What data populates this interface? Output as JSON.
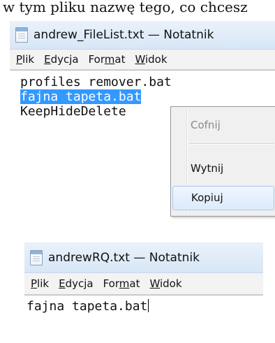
{
  "caption": "w tym pliku nazwę tego, co chcesz",
  "window_top": {
    "title": "andrew_FileList.txt — Notatnik",
    "icon": "notepad-icon",
    "menu": [
      {
        "pre": "",
        "key": "P",
        "post": "lik"
      },
      {
        "pre": "",
        "key": "E",
        "post": "dycja"
      },
      {
        "pre": "For",
        "key": "m",
        "post": "at"
      },
      {
        "pre": "",
        "key": "W",
        "post": "idok"
      }
    ],
    "lines": {
      "line1": "profiles remover.bat",
      "line2_selected": "fajna tapeta.bat",
      "line3": "KeepHideDelete"
    },
    "context_menu": {
      "undo": "Cofnij",
      "cut": "Wytnij",
      "copy": "Kopiuj",
      "highlight_color": "#dcebfc"
    },
    "selection_color": "#3399ff"
  },
  "window_bottom": {
    "title": "andrewRQ.txt — Notatnik",
    "icon": "notepad-icon",
    "menu": [
      {
        "pre": "",
        "key": "P",
        "post": "lik"
      },
      {
        "pre": "",
        "key": "E",
        "post": "dycja"
      },
      {
        "pre": "For",
        "key": "m",
        "post": "at"
      },
      {
        "pre": "",
        "key": "W",
        "post": "idok"
      }
    ],
    "lines": {
      "line1": "fajna tapeta.bat"
    }
  }
}
